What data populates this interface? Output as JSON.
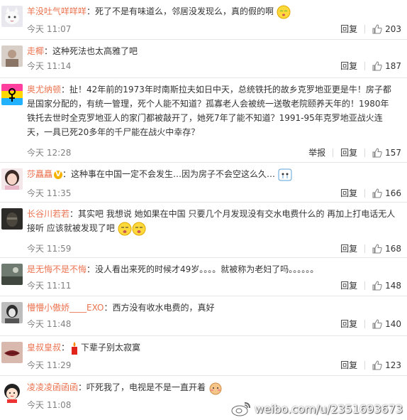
{
  "comments": [
    {
      "user": "羊没吐气咩咩咩",
      "text": "死了不是有味道么，邻居没发现么，真的假的啊",
      "time": "今天 11:07",
      "reply": "回复",
      "likes": "203",
      "avatar_icon": "avatar-cat-icon",
      "emoji": "sleepy-face-icon"
    },
    {
      "user": "走椰",
      "text": "这种死法也太高雅了吧",
      "time": "今天 11:14",
      "reply": "回复",
      "likes": "187",
      "avatar_icon": "avatar-photo-icon"
    },
    {
      "user": "奥尤纳顿",
      "text": "扯！42年前的1973年时南斯拉夫如日中天，总统铁托的故乡克罗地亚更是牛！房子都是国家分配的，有统一管理，死个人能不知道？孤寡老人会被统一送敬老院颐养天年的！1980年铁托去世时全克罗地亚人的家门都被敲开了，她死7年了能不知道？1991-95年克罗地亚战火连天，一具已死20多年的千尸能在战火中幸存？",
      "time": "今天 12:28",
      "report": "举报",
      "reply": "回复",
      "likes": "157",
      "avatar_icon": "avatar-symbol-icon"
    },
    {
      "user": "莎矗矗",
      "text": "这种事在中国一定不会发生…因为房子不会空这么久…",
      "time": "今天 11:35",
      "reply": "回复",
      "likes": "166",
      "avatar_icon": "avatar-girl-icon",
      "emoji": "crying-box-icon",
      "verified": "V"
    },
    {
      "user": "长谷川若若",
      "text": "其实吧 我想说 她如果在中国 只要几个月发现没有交水电费什么的 再加上打电话无人接听 应该就被发现了吧",
      "time": "今天 11:59",
      "reply": "回复",
      "likes": "168",
      "avatar_icon": "avatar-dark-icon",
      "emoji": "smirk-face-icon"
    },
    {
      "user": "是无悔不是不悔",
      "text": "没人看出来死的时候才49岁。。。。就被称为老妇了吗。。。。。。",
      "time": "今天 11:11",
      "reply": "回复",
      "likes": "148",
      "avatar_icon": "avatar-scene-icon"
    },
    {
      "user": "懵懵小傲娇____EXO",
      "text": "西方没有收水电费的，真好",
      "time": "今天 11:48",
      "reply": "回复",
      "likes": "140",
      "avatar_icon": "avatar-bw-icon"
    },
    {
      "user": "皇叔皇叔",
      "text": "下辈子别太寂寞",
      "time": "今天 11:29",
      "reply": "回复",
      "likes": "123",
      "avatar_icon": "avatar-lips-icon",
      "emoji": "candle-icon"
    },
    {
      "user": "凌凌凌函函函",
      "text": "吓死我了，电视是不是一直开着",
      "time": "今天 11:08",
      "reply": "回复",
      "likes": "",
      "avatar_icon": "avatar-cartoon-icon",
      "emoji": "shy-face-icon"
    }
  ],
  "watermark": "weibo.com/u/2351693673",
  "colors": {
    "name": "#eb7350",
    "time": "#808080",
    "divider": "#e6e6e6"
  }
}
